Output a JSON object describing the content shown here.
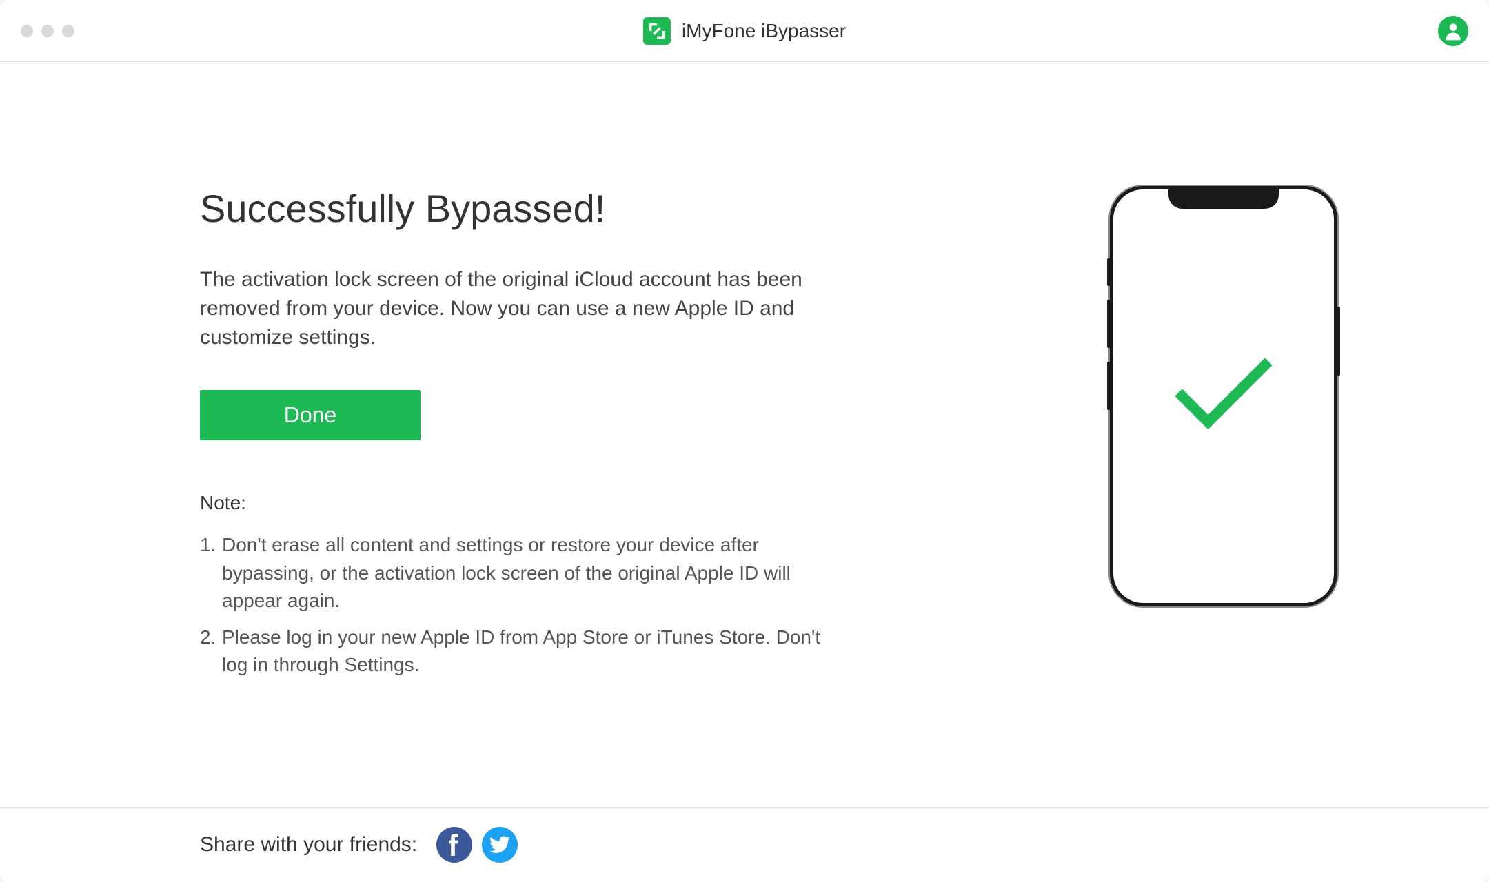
{
  "app": {
    "title": "iMyFone iBypasser"
  },
  "main": {
    "heading": "Successfully Bypassed!",
    "description": "The activation lock screen of the original iCloud account has been removed from your device. Now you can use a new Apple ID and customize settings.",
    "doneButton": "Done",
    "noteLabel": "Note:",
    "notes": [
      "Don't erase all content and settings or restore your device after bypassing, or the activation lock screen of the original Apple ID will appear again.",
      "Please log in your new Apple ID from App Store or iTunes Store. Don't log in through Settings."
    ]
  },
  "footer": {
    "shareText": "Share with your friends:"
  },
  "colors": {
    "accent": "#1db954",
    "facebook": "#3b5998",
    "twitter": "#1da1f2"
  }
}
